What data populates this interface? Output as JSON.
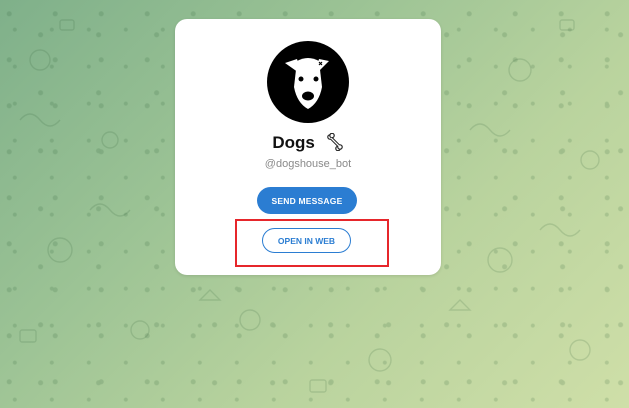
{
  "bot": {
    "name": "Dogs",
    "name_icon": "bone-icon",
    "username": "@dogshouse_bot",
    "avatar_icon": "dog-avatar"
  },
  "actions": {
    "send_message_label": "SEND MESSAGE",
    "open_in_web_label": "OPEN IN WEB"
  },
  "colors": {
    "accent": "#2b7dd2",
    "highlight": "#e6262b",
    "card": "#ffffff",
    "background_start": "#7fb08a",
    "background_end": "#cfdfa8"
  }
}
